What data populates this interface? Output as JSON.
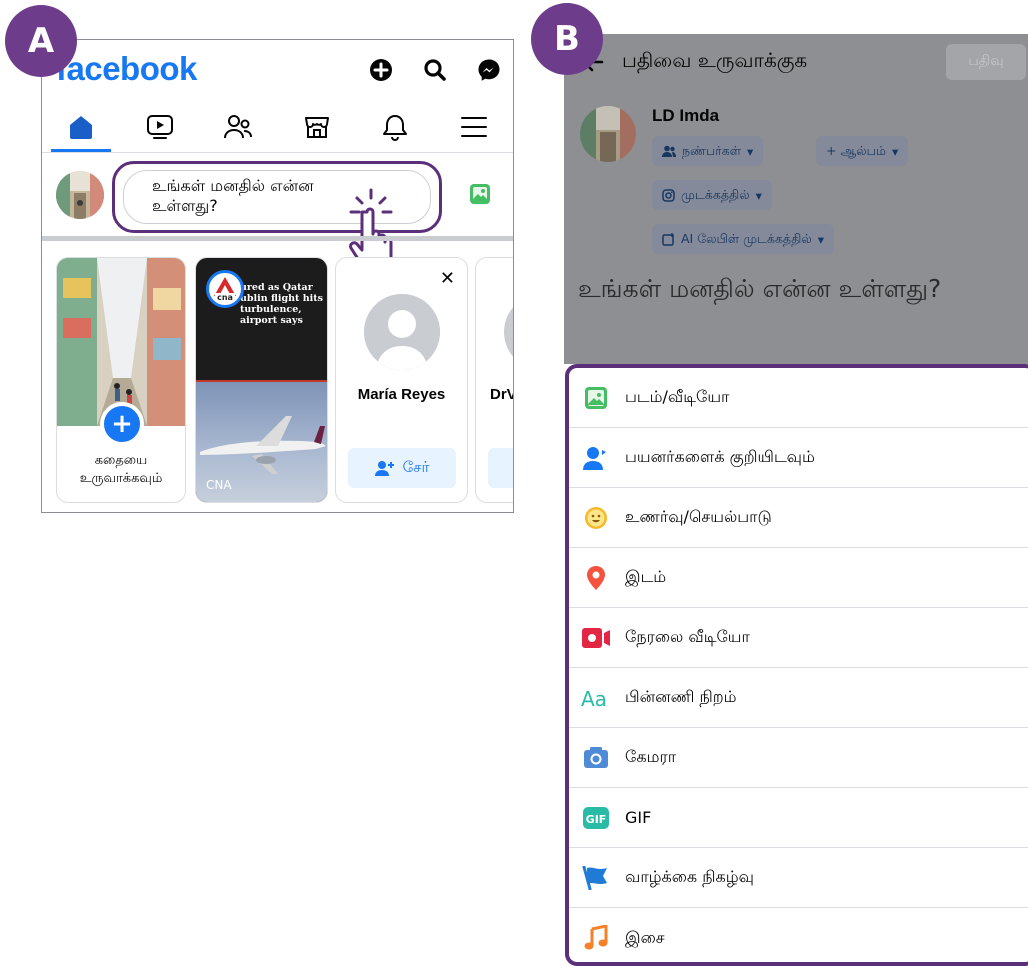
{
  "badges": {
    "a": "A",
    "b": "B"
  },
  "panel_a": {
    "logo": "facebook",
    "top_icons": [
      "plus-circle-icon",
      "search-icon",
      "messenger-icon"
    ],
    "nav": [
      "home-icon",
      "video-icon",
      "friends-icon",
      "marketplace-icon",
      "bell-icon",
      "menu-icon"
    ],
    "composer": {
      "line1": "உங்கள் மனதில் என்ன",
      "line2": "உள்ளது?"
    },
    "stories": {
      "create_line1": "கதையை",
      "create_line2": "உருவாக்கவும்",
      "cna_headline": "ured as Qatar ublin flight hits turbulence, airport says",
      "cna_headline_prefix": "A",
      "cna_logo": "cna",
      "cna_name": "CNA",
      "person_name": "María Reyes",
      "add_label": "சேர்",
      "partial_name": "DrV"
    }
  },
  "panel_b": {
    "title": "பதிவை உருவாக்குக",
    "post_label": "பதிவு",
    "user_name": "LD Imda",
    "chips": {
      "audience": "நண்பர்கள்",
      "album": "+ ஆல்பம்",
      "instagram": "முடக்கத்தில்",
      "ai_label": "AI லேபிள் முடக்கத்தில்"
    },
    "placeholder": "உங்கள் மனதில் என்ன உள்ளது?",
    "options": [
      {
        "icon": "photo-video-icon",
        "label": "படம்/வீடியோ"
      },
      {
        "icon": "tag-people-icon",
        "label": "பயனர்களைக் குறியிடவும்"
      },
      {
        "icon": "feeling-icon",
        "label": "உணர்வு/செயல்பாடு"
      },
      {
        "icon": "location-icon",
        "label": "இடம்"
      },
      {
        "icon": "live-video-icon",
        "label": "நேரலை வீடியோ"
      },
      {
        "icon": "background-color-icon",
        "label": "பின்னணி நிறம்"
      },
      {
        "icon": "camera-icon",
        "label": "கேமரா"
      },
      {
        "icon": "gif-icon",
        "label": "GIF"
      },
      {
        "icon": "life-event-icon",
        "label": "வாழ்க்கை நிகழ்வு"
      },
      {
        "icon": "music-icon",
        "label": "இசை"
      }
    ]
  },
  "colors": {
    "facebook_blue": "#1877f2",
    "highlight_purple": "#5b2f7a",
    "badge_purple": "#6d3d8c",
    "overlay_gray": "#8e8f92"
  }
}
